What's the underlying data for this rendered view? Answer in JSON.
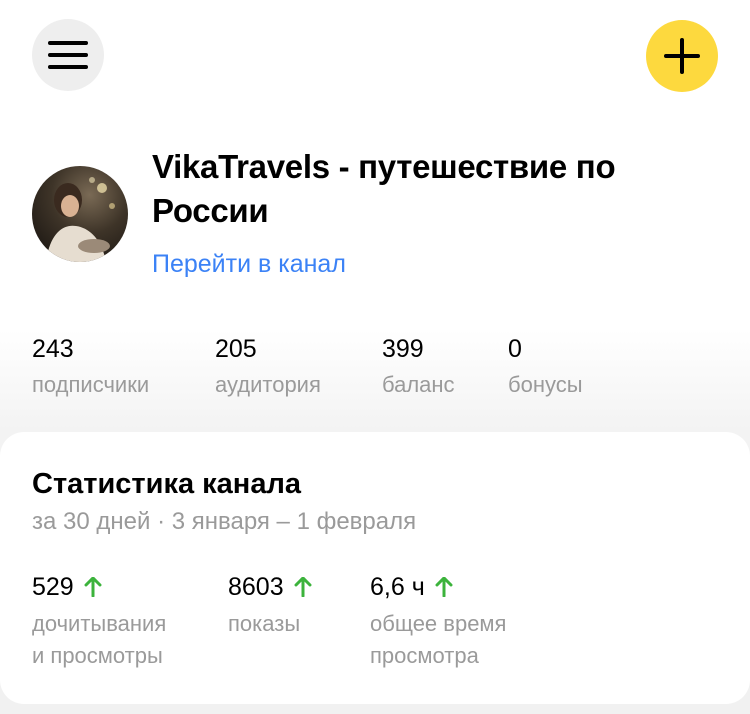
{
  "header": {
    "menu_icon": "hamburger-icon",
    "add_icon": "plus-icon",
    "accent_color": "#fdd93e"
  },
  "channel": {
    "title": "VikaTravels - путешествие по России",
    "link_label": "Перейти в канал",
    "link_color": "#3b82f6"
  },
  "summary": [
    {
      "value": "243",
      "label": "подписчики"
    },
    {
      "value": "205",
      "label": "аудитория"
    },
    {
      "value": "399",
      "label": "баланс"
    },
    {
      "value": "0",
      "label": "бонусы"
    }
  ],
  "stats_card": {
    "title": "Статистика канала",
    "subtitle": "за 30 дней · 3 января – 1 февраля",
    "metrics": [
      {
        "value": "529",
        "label": "дочитывания\nи просмотры",
        "trend": "up"
      },
      {
        "value": "8603",
        "label": "показы",
        "trend": "up"
      },
      {
        "value": "6,6 ч",
        "label": "общее время\nпросмотра",
        "trend": "up"
      }
    ],
    "trend_color": "#3cb33c"
  }
}
